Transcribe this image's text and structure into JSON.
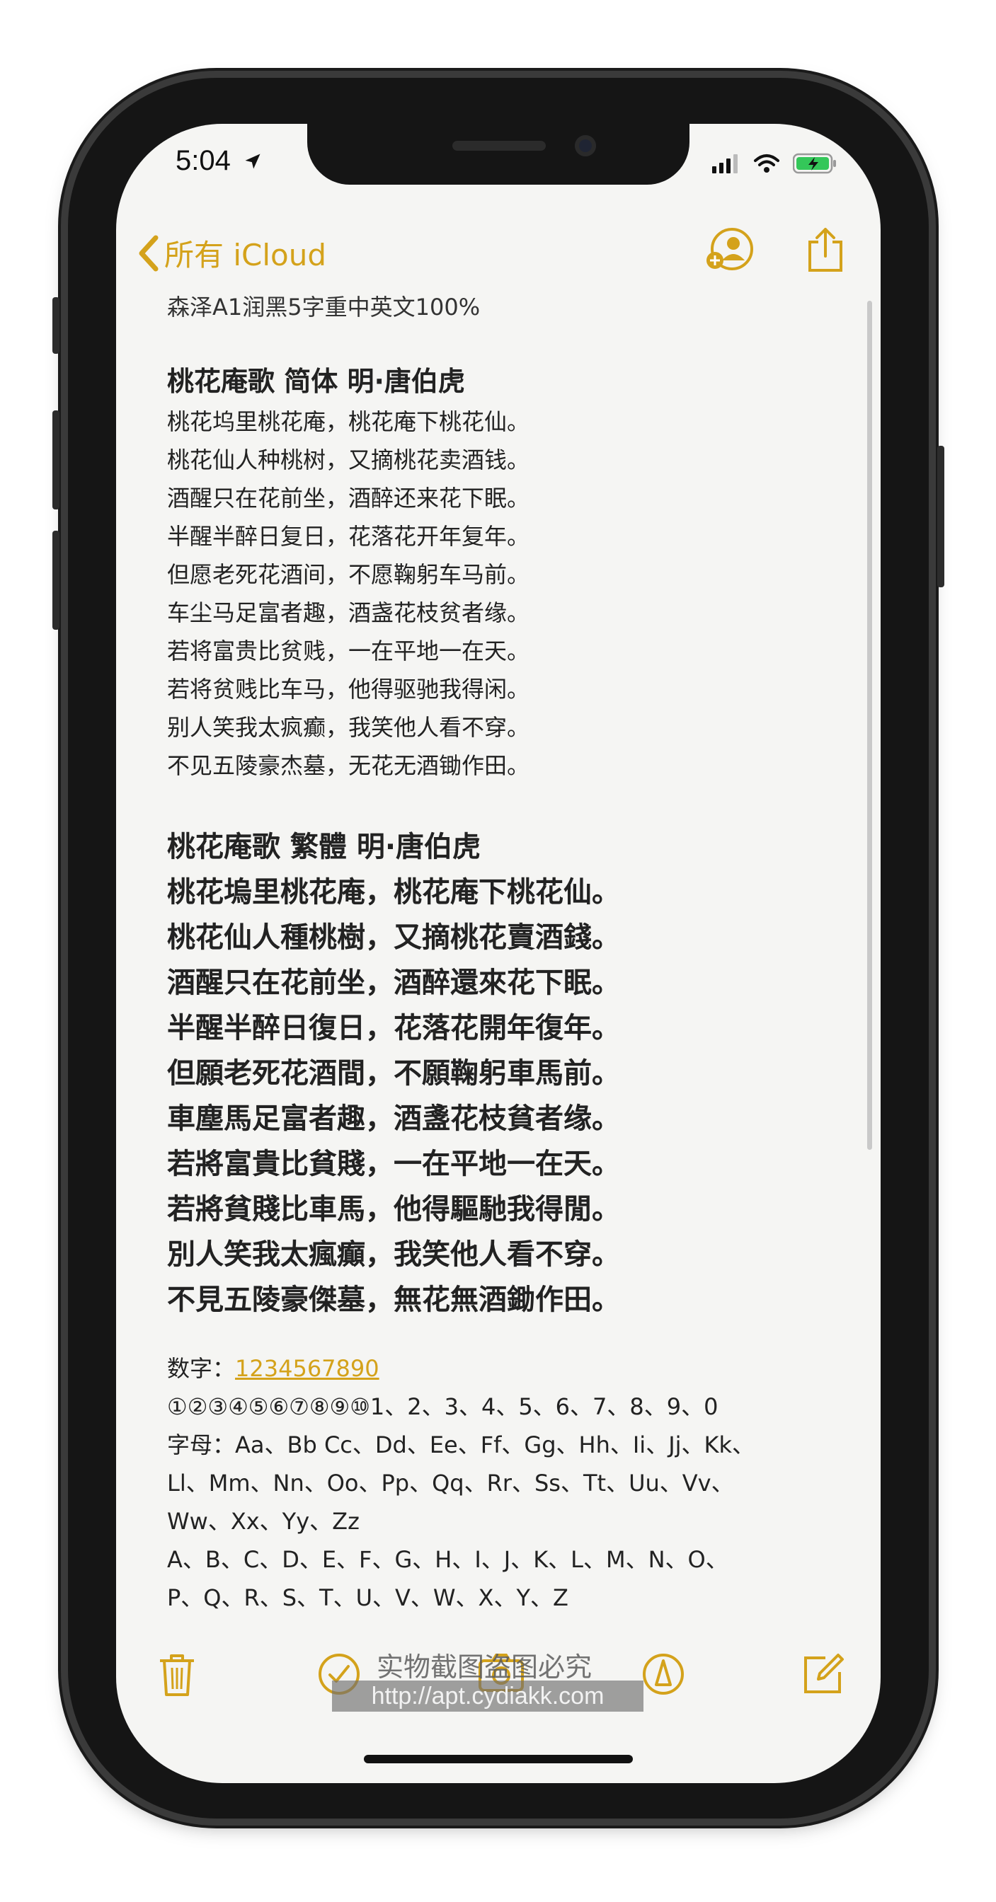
{
  "status": {
    "time": "5:04"
  },
  "nav": {
    "back_label": "所有 iCloud"
  },
  "note": {
    "meta": "森泽A1润黑5字重中英文100%",
    "simplified": {
      "title": "桃花庵歌 简体  明·唐伯虎",
      "lines": [
        "桃花坞里桃花庵，桃花庵下桃花仙。",
        "桃花仙人种桃树，又摘桃花卖酒钱。",
        "酒醒只在花前坐，酒醉还来花下眠。",
        "半醒半醉日复日，花落花开年复年。",
        "但愿老死花酒间，不愿鞠躬车马前。",
        "车尘马足富者趣，酒盏花枝贫者缘。",
        "若将富贵比贫贱，一在平地一在天。",
        "若将贫贱比车马，他得驱驰我得闲。",
        "别人笑我太疯癫，我笑他人看不穿。",
        "不见五陵豪杰墓，无花无酒锄作田。"
      ]
    },
    "traditional": {
      "title": "桃花庵歌 繁體    明·唐伯虎",
      "lines": [
        "桃花塢里桃花庵，桃花庵下桃花仙。",
        "桃花仙人種桃樹，又摘桃花賣酒錢。",
        "酒醒只在花前坐，酒醉還來花下眠。",
        "半醒半醉日復日，花落花開年復年。",
        "但願老死花酒間，不願鞠躬車馬前。",
        "車塵馬足富者趣，酒盞花枝貧者缘。",
        "若將富貴比貧賤，一在平地一在天。",
        "若將貧賤比車馬，他得驅馳我得閒。",
        "別人笑我太瘋癲，我笑他人看不穿。",
        "不見五陵豪傑墓，無花無酒鋤作田。"
      ]
    },
    "digits_label": "数字：",
    "digits_link": "1234567890",
    "misc_lines": [
      "①②③④⑤⑥⑦⑧⑨⑩1、2、3、4、5、6、7、8、9、0",
      "字母：Aa、Bb Cc、Dd、Ee、Ff、Gg、Hh、Ii、Jj、Kk、",
      "Ll、Mm、Nn、Oo、Pp、Qq、Rr、Ss、Tt、Uu、Vv、",
      "Ww、Xx、Yy、Zz",
      "A、B、C、D、E、F、G、H、I、J、K、L、M、N、O、",
      "P、Q、R、S、T、U、V、W、X、Y、Z"
    ]
  },
  "watermark": {
    "text": "实物截图盗图必究",
    "url": "http://apt.cydiakk.com"
  },
  "colors": {
    "accent": "#d4a21b",
    "battery": "#34c759"
  },
  "icons": [
    "location-arrow-icon",
    "signal-icon",
    "wifi-icon",
    "battery-charging-icon",
    "chevron-left-icon",
    "add-person-icon",
    "share-icon",
    "trash-icon",
    "checklist-icon",
    "camera-icon",
    "markup-icon",
    "compose-icon"
  ]
}
